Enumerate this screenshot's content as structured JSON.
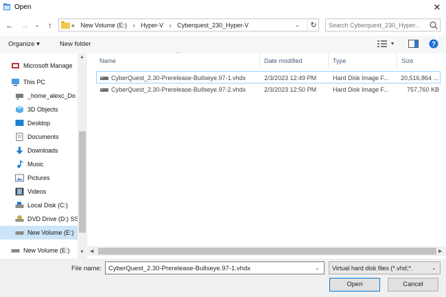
{
  "window": {
    "title": "Open"
  },
  "nav": {
    "address_crumbs": [
      "«",
      "New Volume (E:)",
      "›",
      "Hyper-V",
      "›",
      "Cyberquest_230_Hyper-V"
    ],
    "search_placeholder": "Search Cyberquest_230_Hyper..."
  },
  "toolbar": {
    "organize_label": "Organize ▾",
    "new_folder_label": "New folder"
  },
  "sidebar": {
    "items": [
      {
        "label": "Microsoft Manage",
        "icon": "network-app-icon"
      },
      {
        "label": "This PC",
        "icon": "computer-icon"
      },
      {
        "label": "_home_alexc_Do",
        "icon": "network-drive-icon"
      },
      {
        "label": "3D Objects",
        "icon": "cube-icon"
      },
      {
        "label": "Desktop",
        "icon": "desktop-icon"
      },
      {
        "label": "Documents",
        "icon": "documents-icon"
      },
      {
        "label": "Downloads",
        "icon": "download-arrow-icon"
      },
      {
        "label": "Music",
        "icon": "music-note-icon"
      },
      {
        "label": "Pictures",
        "icon": "pictures-icon"
      },
      {
        "label": "Videos",
        "icon": "film-icon"
      },
      {
        "label": "Local Disk (C:)",
        "icon": "disk-icon"
      },
      {
        "label": "DVD Drive (D:) SS",
        "icon": "dvd-drive-icon"
      },
      {
        "label": "New Volume (E:)",
        "icon": "drive-icon"
      },
      {
        "label": "New Volume (E:)",
        "icon": "drive-icon"
      }
    ]
  },
  "columns": {
    "name": "Name",
    "date": "Date modified",
    "type": "Type",
    "size": "Size"
  },
  "files": [
    {
      "name": "CyberQuest_2.30-Prerelease-Bullseye.97-1.vhdx",
      "date": "2/3/2023 12:49 PM",
      "type": "Hard Disk Image F...",
      "size": "20,516,864 ..."
    },
    {
      "name": "CyberQuest_2.30-Prerelease-Bullseye.97-2.vhdx",
      "date": "2/3/2023 12:50 PM",
      "type": "Hard Disk Image F...",
      "size": "757,760 KB"
    }
  ],
  "bottom": {
    "file_name_label": "File name:",
    "file_name_value": "CyberQuest_2.30-Prerelease-Bullseye.97-1.vhdx",
    "file_type_value": "Virtual hard disk files  (*.vhd;*.",
    "open_label": "Open",
    "cancel_label": "Cancel"
  },
  "colors": {
    "accent": "#0078d7",
    "selection": "#cce4f7",
    "help": "#1e6fd9"
  }
}
